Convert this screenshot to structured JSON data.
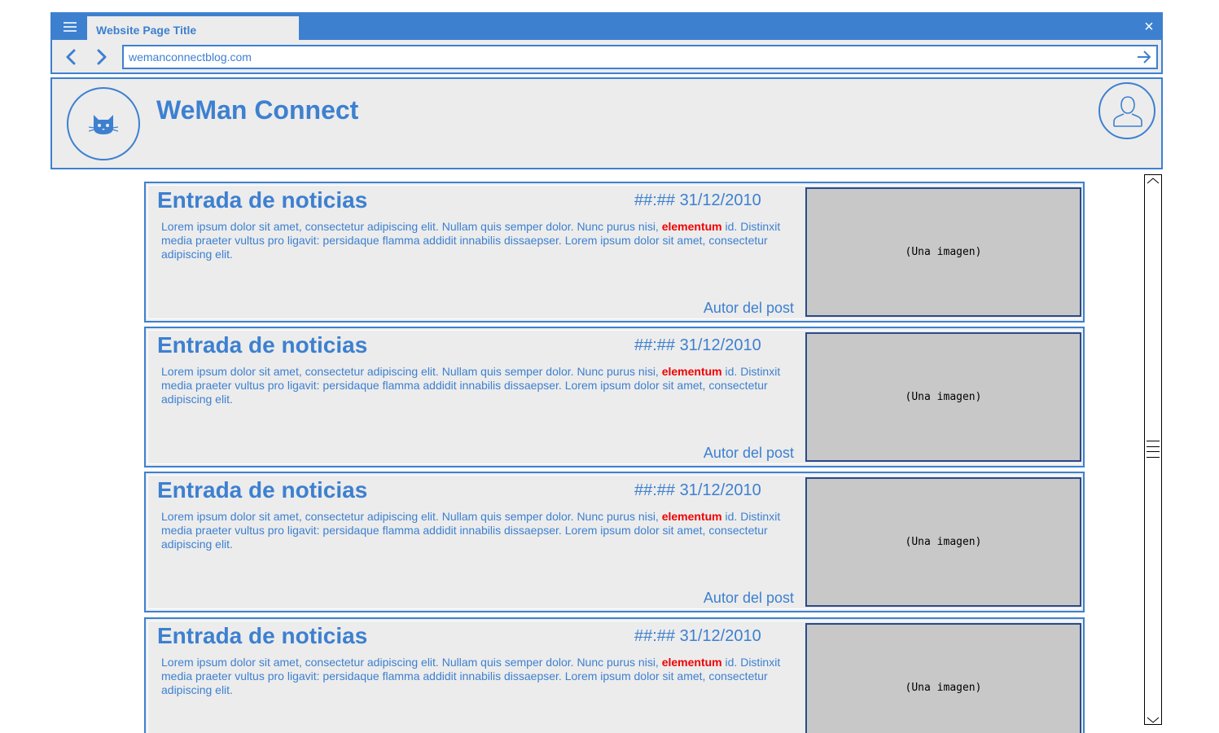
{
  "browser": {
    "tab_title": "Website Page Title",
    "address": "wemanconnectblog.com",
    "close_glyph": "×",
    "icons": {
      "menu": "menu-icon",
      "back": "chevron-left-icon",
      "forward": "chevron-right-icon",
      "go": "arrow-right-icon",
      "close": "close-icon"
    }
  },
  "header": {
    "site_title": "WeMan Connect",
    "logo_icon": "cat-icon",
    "avatar_icon": "user-icon"
  },
  "posts": [
    {
      "title": "Entrada de noticias",
      "datetime": "##:## 31/12/2010",
      "body_before": "Lorem ipsum dolor sit amet, consectetur adipiscing elit. Nullam quis semper dolor. Nunc purus nisi, ",
      "body_highlight": "elementum",
      "body_after": " id. Distinxit  media praeter vultus pro ligavit: persidaque flamma addidit innabilis dissaepser. Lorem ipsum dolor sit amet, consectetur adipiscing elit.",
      "author": "Autor del post",
      "image_label": "(Una imagen)"
    },
    {
      "title": "Entrada de noticias",
      "datetime": "##:## 31/12/2010",
      "body_before": "Lorem ipsum dolor sit amet, consectetur adipiscing elit. Nullam quis semper dolor. Nunc purus nisi, ",
      "body_highlight": "elementum",
      "body_after": " id. Distinxit  media praeter vultus pro ligavit: persidaque flamma addidit innabilis dissaepser. Lorem ipsum dolor sit amet, consectetur adipiscing elit.",
      "author": "Autor del post",
      "image_label": "(Una imagen)"
    },
    {
      "title": "Entrada de noticias",
      "datetime": "##:## 31/12/2010",
      "body_before": "Lorem ipsum dolor sit amet, consectetur adipiscing elit. Nullam quis semper dolor. Nunc purus nisi, ",
      "body_highlight": "elementum",
      "body_after": " id. Distinxit  media praeter vultus pro ligavit: persidaque flamma addidit innabilis dissaepser. Lorem ipsum dolor sit amet, consectetur adipiscing elit.",
      "author": "Autor del post",
      "image_label": "(Una imagen)"
    },
    {
      "title": "Entrada de noticias",
      "datetime": "##:## 31/12/2010",
      "body_before": "Lorem ipsum dolor sit amet, consectetur adipiscing elit. Nullam quis semper dolor. Nunc purus nisi, ",
      "body_highlight": "elementum",
      "body_after": " id. Distinxit  media praeter vultus pro ligavit: persidaque flamma addidit innabilis dissaepser. Lorem ipsum dolor sit amet, consectetur adipiscing elit.",
      "author": "",
      "image_label": "(Una imagen)"
    }
  ],
  "colors": {
    "accent": "#3d80d0",
    "panel_background": "#ececec",
    "image_placeholder": "#c8c8c8",
    "highlight": "#f00000"
  },
  "scrollbar": {
    "up_icon": "chevron-up-icon",
    "down_icon": "chevron-down-icon",
    "thumb_icon": "grip-lines-icon"
  }
}
